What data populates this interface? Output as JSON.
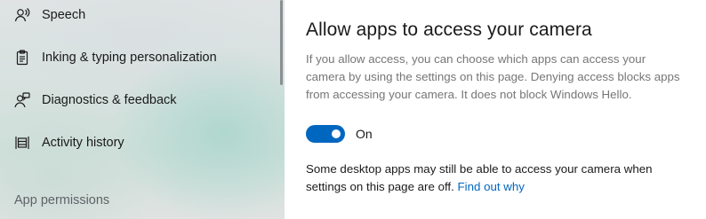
{
  "sidebar": {
    "items": [
      {
        "label": "Speech",
        "icon": "speech-icon"
      },
      {
        "label": "Inking & typing personalization",
        "icon": "clipboard-icon"
      },
      {
        "label": "Diagnostics & feedback",
        "icon": "person-feedback-icon"
      },
      {
        "label": "Activity history",
        "icon": "activity-history-icon"
      }
    ],
    "section_header": "App permissions"
  },
  "main": {
    "title": "Allow apps to access your camera",
    "description": "If you allow access, you can choose which apps can access your camera by using the settings on this page. Denying access blocks apps from accessing your camera. It does not block Windows Hello.",
    "toggle": {
      "state_label": "On",
      "on": true
    },
    "note_text": "Some desktop apps may still be able to access your camera when settings on this page are off.",
    "note_link": "Find out why"
  },
  "colors": {
    "accent": "#0067c0",
    "secondary_text": "#767676"
  }
}
